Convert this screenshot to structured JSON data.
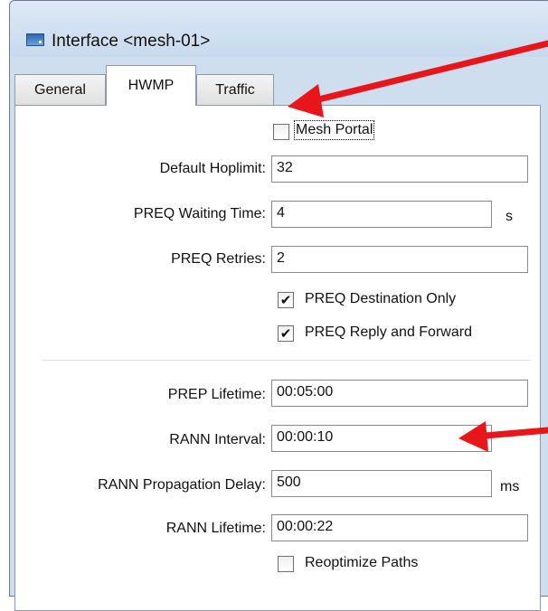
{
  "window": {
    "title": "Interface <mesh-01>"
  },
  "tabs": [
    {
      "label": "General"
    },
    {
      "label": "HWMP"
    },
    {
      "label": "Traffic"
    }
  ],
  "form": {
    "mesh_portal": {
      "label": "Mesh Portal",
      "checked": false
    },
    "default_hoplimit": {
      "label": "Default Hoplimit:",
      "value": "32"
    },
    "preq_waiting_time": {
      "label": "PREQ Waiting Time:",
      "value": "4",
      "unit": "s"
    },
    "preq_retries": {
      "label": "PREQ Retries:",
      "value": "2"
    },
    "preq_destination_only": {
      "label": "PREQ Destination Only",
      "checked": true
    },
    "preq_reply_and_forward": {
      "label": "PREQ Reply and Forward",
      "checked": true
    },
    "prep_lifetime": {
      "label": "PREP Lifetime:",
      "value": "00:05:00"
    },
    "rann_interval": {
      "label": "RANN Interval:",
      "value": "00:00:10"
    },
    "rann_propagation_delay": {
      "label": "RANN Propagation Delay:",
      "value": "500",
      "unit": "ms"
    },
    "rann_lifetime": {
      "label": "RANN Lifetime:",
      "value": "00:00:22"
    },
    "reoptimize_paths": {
      "label": "Reoptimize Paths",
      "checked": false
    }
  },
  "check_glyph": "✔",
  "colors": {
    "annotation_arrow": "#e8151b"
  },
  "icons": [
    "app-window-icon",
    "annotation-arrow-icon"
  ]
}
